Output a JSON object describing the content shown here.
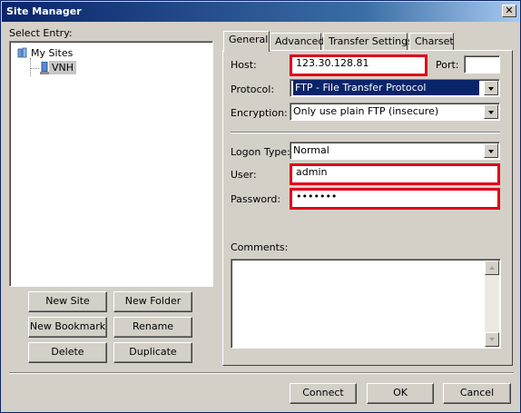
{
  "window": {
    "title": "Site Manager",
    "close_glyph": "✕"
  },
  "tree": {
    "select_entry_label": "Select Entry:",
    "root_label": "My Sites",
    "child_label": "VNH"
  },
  "left_buttons": {
    "new_site": "New Site",
    "new_folder": "New Folder",
    "new_bookmark": "New Bookmark",
    "rename": "Rename",
    "delete": "Delete",
    "duplicate": "Duplicate"
  },
  "tabs": [
    "General",
    "Advanced",
    "Transfer Settings",
    "Charset"
  ],
  "general": {
    "host_label": "Host:",
    "host_value": "123.30.128.81",
    "port_label": "Port:",
    "port_value": "",
    "protocol_label": "Protocol:",
    "protocol_value": "FTP - File Transfer Protocol",
    "encryption_label": "Encryption:",
    "encryption_value": "Only use plain FTP (insecure)",
    "logon_type_label": "Logon Type:",
    "logon_type_value": "Normal",
    "user_label": "User:",
    "user_value": "admin",
    "password_label": "Password:",
    "password_value": "•••••••",
    "comments_label": "Comments:",
    "comments_value": ""
  },
  "footer_buttons": {
    "connect": "Connect",
    "ok": "OK",
    "cancel": "Cancel"
  },
  "colors": {
    "highlight_border": "#e0001a",
    "title_bar": "#0a246a",
    "selection": "#0a246a"
  },
  "icons": {
    "root": "folder-icon",
    "site": "server-icon",
    "close": "close-icon"
  }
}
